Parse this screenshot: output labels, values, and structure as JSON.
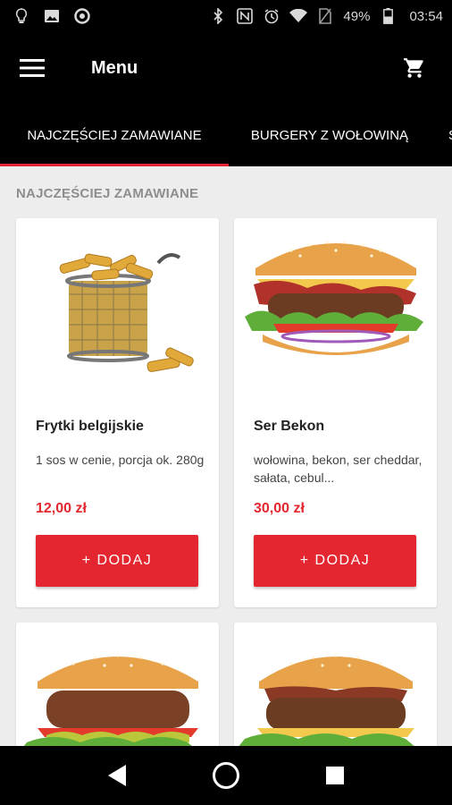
{
  "status_bar": {
    "battery": "49%",
    "time": "03:54",
    "icons": [
      "lightbulb-icon",
      "image-icon",
      "circle-icon",
      "bluetooth-icon",
      "nfc-icon",
      "alarm-icon",
      "wifi-icon",
      "no-sim-icon",
      "battery-icon"
    ]
  },
  "app_bar": {
    "title": "Menu",
    "menu_icon": "hamburger-icon",
    "cart_icon": "cart-icon"
  },
  "tabs": [
    {
      "label": "NAJCZĘŚCIEJ ZAMAWIANE",
      "active": true
    },
    {
      "label": "BURGERY Z WOŁOWINĄ",
      "active": false
    },
    {
      "label": "S",
      "active": false
    }
  ],
  "section": {
    "title": "NAJCZĘŚCIEJ ZAMAWIANE"
  },
  "products": [
    {
      "name": "Frytki belgijskie",
      "description": "1 sos w cenie, porcja ok. 280g",
      "price": "12,00 zł",
      "button": "+ DODAJ",
      "image": "fries-basket"
    },
    {
      "name": "Ser Bekon",
      "description": "wołowina, bekon, ser cheddar, sałata, cebul...",
      "price": "30,00 zł",
      "button": "+ DODAJ",
      "image": "bacon-cheese-burger"
    },
    {
      "image": "beef-burger"
    },
    {
      "image": "bbq-burger"
    }
  ],
  "nav_bar": {
    "icons": [
      "back-icon",
      "home-icon",
      "recents-icon"
    ]
  },
  "colors": {
    "accent": "#e3262f",
    "bar": "#000000",
    "background": "#ededed"
  }
}
